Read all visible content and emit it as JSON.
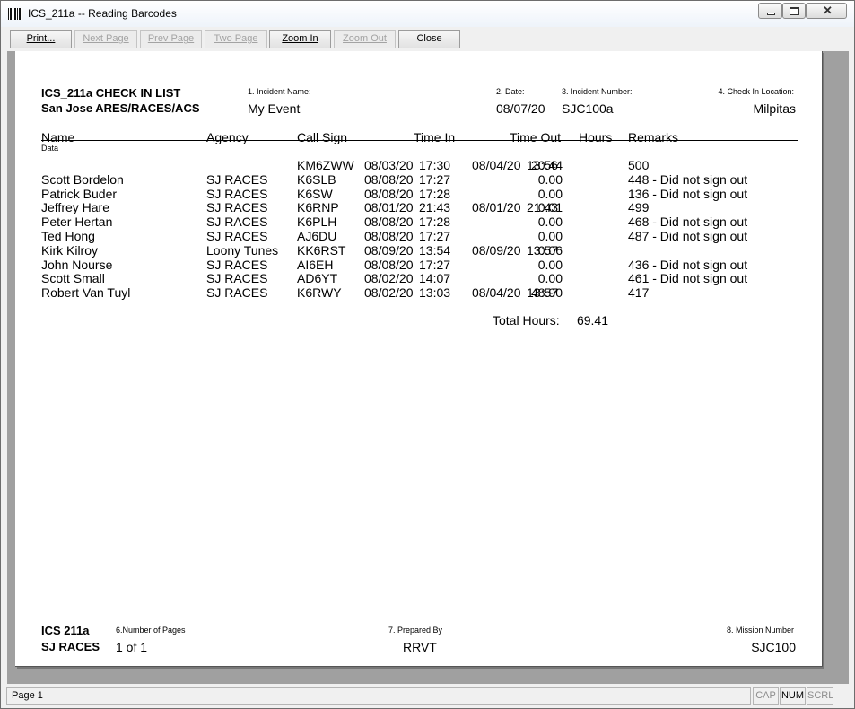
{
  "window": {
    "title": "ICS_211a -- Reading Barcodes"
  },
  "toolbar": {
    "print": "Print...",
    "next_page": "Next Page",
    "prev_page": "Prev Page",
    "two_page": "Two Page",
    "zoom_in": "Zoom In",
    "zoom_out": "Zoom Out",
    "close": "Close"
  },
  "report": {
    "title": "ICS_211a CHECK IN LIST",
    "org": "San Jose ARES/RACES/ACS",
    "incident_name_label": "1. Incident Name:",
    "incident_name": "My Event",
    "date_label": "2. Date:",
    "date": "08/07/20",
    "incident_number_label": "3. Incident Number:",
    "incident_number": "SJC100a",
    "location_label": "4. Check In Location:",
    "location": "Milpitas",
    "columns": {
      "name": "Name",
      "agency": "Agency",
      "call_sign": "Call Sign",
      "time_in": "Time In",
      "time_out": "Time Out",
      "hours": "Hours",
      "remarks": "Remarks"
    },
    "data_label": "Data",
    "rows": [
      {
        "name": "",
        "agency": "",
        "call": "KM6ZWW",
        "in_date": "08/03/20",
        "in_time": "17:30",
        "out_date": "08/04/20",
        "out_time": "13:56",
        "hours": "20.44",
        "remarks": "500"
      },
      {
        "name": "Scott Bordelon",
        "agency": "SJ RACES",
        "call": "K6SLB",
        "in_date": "08/08/20",
        "in_time": "17:27",
        "out_date": "",
        "out_time": "",
        "hours": "0.00",
        "remarks": "448 - Did not sign out"
      },
      {
        "name": "Patrick Buder",
        "agency": "SJ RACES",
        "call": "K6SW",
        "in_date": "08/08/20",
        "in_time": "17:28",
        "out_date": "",
        "out_time": "",
        "hours": "0.00",
        "remarks": "136 - Did not sign out"
      },
      {
        "name": "Jeffrey Hare",
        "agency": "SJ RACES",
        "call": "K6RNP",
        "in_date": "08/01/20",
        "in_time": "21:43",
        "out_date": "08/01/20",
        "out_time": "21:43",
        "hours": "0.01",
        "remarks": "499"
      },
      {
        "name": "Peter Hertan",
        "agency": "SJ RACES",
        "call": "K6PLH",
        "in_date": "08/08/20",
        "in_time": "17:28",
        "out_date": "",
        "out_time": "",
        "hours": "0.00",
        "remarks": "468 - Did not sign out"
      },
      {
        "name": "Ted Hong",
        "agency": "SJ RACES",
        "call": "AJ6DU",
        "in_date": "08/08/20",
        "in_time": "17:27",
        "out_date": "",
        "out_time": "",
        "hours": "0.00",
        "remarks": "487 - Did not sign out"
      },
      {
        "name": "Kirk Kilroy",
        "agency": "Loony Tunes",
        "call": "KK6RST",
        "in_date": "08/09/20",
        "in_time": "13:54",
        "out_date": "08/09/20",
        "out_time": "13:57",
        "hours": "0.06",
        "remarks": ""
      },
      {
        "name": "John Nourse",
        "agency": "SJ RACES",
        "call": "AI6EH",
        "in_date": "08/08/20",
        "in_time": "17:27",
        "out_date": "",
        "out_time": "",
        "hours": "0.00",
        "remarks": "436 - Did not sign out"
      },
      {
        "name": "Scott Small",
        "agency": "SJ RACES",
        "call": "AD6YT",
        "in_date": "08/02/20",
        "in_time": "14:07",
        "out_date": "",
        "out_time": "",
        "hours": "0.00",
        "remarks": "461 - Did not sign out"
      },
      {
        "name": "Robert Van Tuyl",
        "agency": "SJ RACES",
        "call": "K6RWY",
        "in_date": "08/02/20",
        "in_time": "13:03",
        "out_date": "08/04/20",
        "out_time": "13:57",
        "hours": "48.90",
        "remarks": "417"
      }
    ],
    "total_label": "Total Hours:",
    "total_value": "69.41",
    "footer": {
      "form": "ICS 211a",
      "org": "SJ RACES",
      "pages_label": "6.Number of Pages",
      "pages": "1 of 1",
      "prepared_label": "7. Prepared By",
      "prepared": "RRVT",
      "mission_label": "8. Mission Number",
      "mission": "SJC100"
    }
  },
  "status": {
    "page": "Page 1",
    "cap": "CAP",
    "num": "NUM",
    "scrl": "SCRL"
  }
}
